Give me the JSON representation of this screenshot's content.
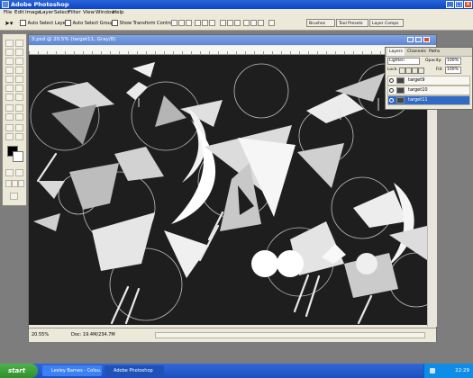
{
  "app": {
    "title": "Adobe Photoshop"
  },
  "menu": [
    "File",
    "Edit",
    "Image",
    "Layer",
    "Select",
    "Filter",
    "View",
    "Window",
    "Help"
  ],
  "options": {
    "auto_select_layer": "Auto Select Layer",
    "auto_select_groups": "Auto Select Groups",
    "show_transform": "Show Transform Controls"
  },
  "palette_tabs": [
    "Brushes",
    "Tool Presets",
    "Layer Comps"
  ],
  "document": {
    "title": "3.psd @ 20.5% (target11, Gray/8)",
    "zoom": "20.55%",
    "doc_info": "Doc: 19.4M/234.7M"
  },
  "layers_panel": {
    "tabs": [
      "Layers",
      "Channels",
      "Paths"
    ],
    "blend_mode": "Lighten",
    "opacity_label": "Opacity:",
    "opacity_value": "100%",
    "lock_label": "Lock:",
    "fill_label": "Fill:",
    "fill_value": "100%",
    "layers": [
      {
        "name": "target9"
      },
      {
        "name": "target10"
      },
      {
        "name": "target11"
      }
    ]
  },
  "taskbar": {
    "start": "start",
    "tasks": [
      "Lesley Barnes - Colou...",
      "Adobe Photoshop"
    ],
    "clock": "22:29"
  },
  "colors": {
    "canvas_bg": "#1e1e1e",
    "xp_blue": "#2a63d8",
    "xp_start": "#3c9c39",
    "selected_layer": "#316ac5"
  }
}
